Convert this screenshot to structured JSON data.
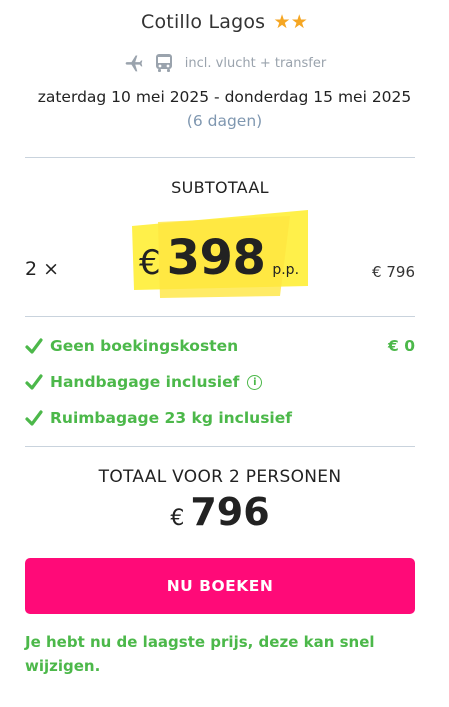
{
  "hotel": {
    "name": "Cotillo Lagos",
    "stars": "★★"
  },
  "inclusions": {
    "text": "incl. vlucht + transfer",
    "icons": [
      "plane-icon",
      "bus-icon"
    ]
  },
  "travel": {
    "dates": "zaterdag 10 mei 2025 - donderdag 15 mei 2025",
    "duration": "(6 dagen)"
  },
  "subtotal": {
    "heading": "SUBTOTAAL",
    "quantity": "2 ×",
    "currency": "€",
    "price_per_person": "398",
    "per_person_label": "p.p.",
    "total": "€ 796"
  },
  "features": [
    {
      "label": "Geen boekingskosten",
      "value": "€ 0"
    },
    {
      "label": "Handbagage inclusief",
      "info_icon": "i"
    },
    {
      "label": "Ruimbagage 23 kg inclusief"
    }
  ],
  "total": {
    "heading": "TOTAAL VOOR 2 PERSONEN",
    "currency": "€",
    "amount": "796"
  },
  "cta": {
    "label": "NU BOEKEN"
  },
  "notice": "Je hebt nu de laagste prijs, deze kan snel wijzigen.",
  "colors": {
    "accent_pink": "#ff0a78",
    "success_green": "#4cb84a",
    "highlight_yellow": "#fff04a",
    "star_orange": "#f5a623"
  }
}
